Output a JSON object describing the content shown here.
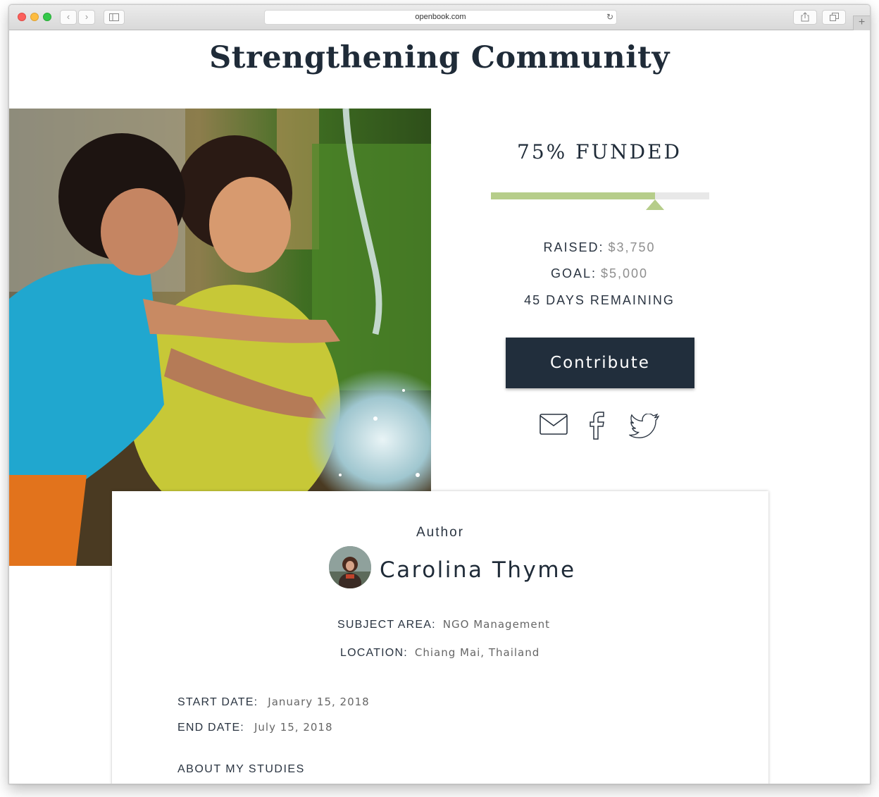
{
  "browser": {
    "url": "openbook.com"
  },
  "page": {
    "title": "Strengthening Community"
  },
  "funding": {
    "headline": "75% FUNDED",
    "progress_fraction": 0.75,
    "raised_label": "RAISED:",
    "raised_value": "$3,750",
    "goal_label": "GOAL:",
    "goal_value": "$5,000",
    "remaining": "45 DAYS REMAINING",
    "contribute_label": "Contribute",
    "accent_color": "#b6cd8a",
    "button_color": "#212e3c"
  },
  "share": {
    "icons": [
      "mail-icon",
      "facebook-icon",
      "twitter-icon"
    ]
  },
  "author": {
    "label": "Author",
    "name": "Carolina Thyme",
    "subject_label": "SUBJECT AREA:",
    "subject_value": "NGO Management",
    "location_label": "LOCATION:",
    "location_value": "Chiang Mai, Thailand",
    "start_label": "START DATE:",
    "start_value": "January 15, 2018",
    "end_label": "END DATE:",
    "end_value": "July 15, 2018",
    "about_label": "ABOUT MY STUDIES"
  }
}
